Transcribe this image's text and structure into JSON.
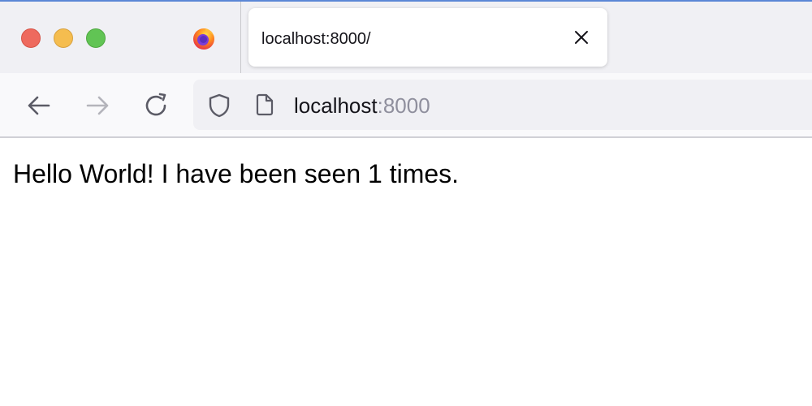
{
  "window": {
    "controls": [
      "close",
      "minimize",
      "maximize"
    ],
    "colors": {
      "close": "#ee6a5e",
      "minimize": "#f5bd4f",
      "maximize": "#61c454"
    }
  },
  "tabs": [
    {
      "title": "localhost:8000/",
      "active": true,
      "close_icon": "close-icon"
    }
  ],
  "browser_icon": "firefox-logo-icon",
  "navigation": {
    "back_icon": "arrow-left-icon",
    "forward_icon": "arrow-right-icon",
    "reload_icon": "reload-icon"
  },
  "urlbar": {
    "security_icon": "shield-icon",
    "page_icon": "document-icon",
    "host": "localhost",
    "port": ":8000"
  },
  "page": {
    "text": "Hello World! I have been seen 1 times."
  }
}
